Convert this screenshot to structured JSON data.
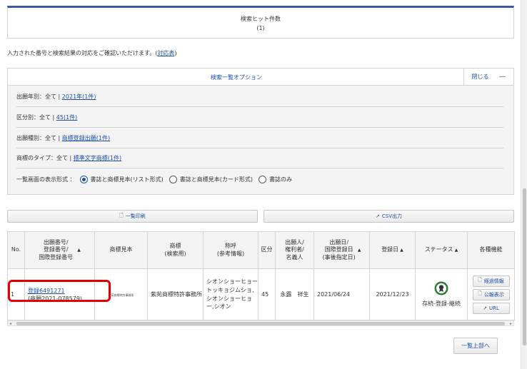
{
  "hits": {
    "title": "検索ヒット件数",
    "count": "(1)"
  },
  "note": {
    "text": "入力された番号と検索結果の対応をご確認いただけます。(",
    "link": "対応表",
    "close": ")"
  },
  "options": {
    "title": "検索一覧オプション",
    "close_label": "閉じる",
    "close_icon": "—",
    "rows": [
      {
        "prefix": "出願年別：全て | ",
        "link": "2021年(1件)"
      },
      {
        "prefix": "区分別：全て | ",
        "link": "45(1件)"
      },
      {
        "prefix": "出願種別：全て | ",
        "link": "商標登録出願(1件)"
      },
      {
        "prefix": "商標のタイプ：全て | ",
        "link": "標準文字商標(1件)"
      }
    ],
    "display_label": "一覧画面の表示形式 ：",
    "display_options": [
      "書誌と商標見本(リスト形式)",
      "書誌と商標見本(カード形式)",
      "書誌のみ"
    ],
    "display_selected": "書誌と商標見本(リスト形式)"
  },
  "actions": {
    "print": "一覧印刷",
    "csv": "CSV出力"
  },
  "table": {
    "headers": {
      "no": "No.",
      "number": [
        "出願番号/",
        "登録番号/",
        "国際登録番号"
      ],
      "sample": "商標見本",
      "mark": [
        "商標",
        "(検索用)"
      ],
      "call": [
        "称呼",
        "(参考情報)"
      ],
      "class": "区分",
      "applicant": [
        "出願人/",
        "権利者/",
        "名義人"
      ],
      "date": [
        "出願日/",
        "国際登録日",
        "(事後指定日)"
      ],
      "reg_date": "登録日",
      "status": "ステータス",
      "functions": "各種機能"
    },
    "sort_icon": "▲",
    "rows": [
      {
        "no": "1",
        "reg_link": "登録6491271",
        "app_no": "(商願2021-078579)",
        "sample_text": "紫苑商標特許事務所",
        "mark": "紫苑商標特許事務所",
        "call": "シオンショーヒョートッキョジムショ,シオンショーヒョー,シオン",
        "class": "45",
        "applicant": "永露　祥生",
        "date": "2021/06/24",
        "reg_date": "2021/12/23",
        "status": "存続-登録-継続",
        "buttons": [
          "経過情報",
          "公報表示",
          "URL"
        ]
      }
    ]
  },
  "back_to_top": "一覧上部へ"
}
